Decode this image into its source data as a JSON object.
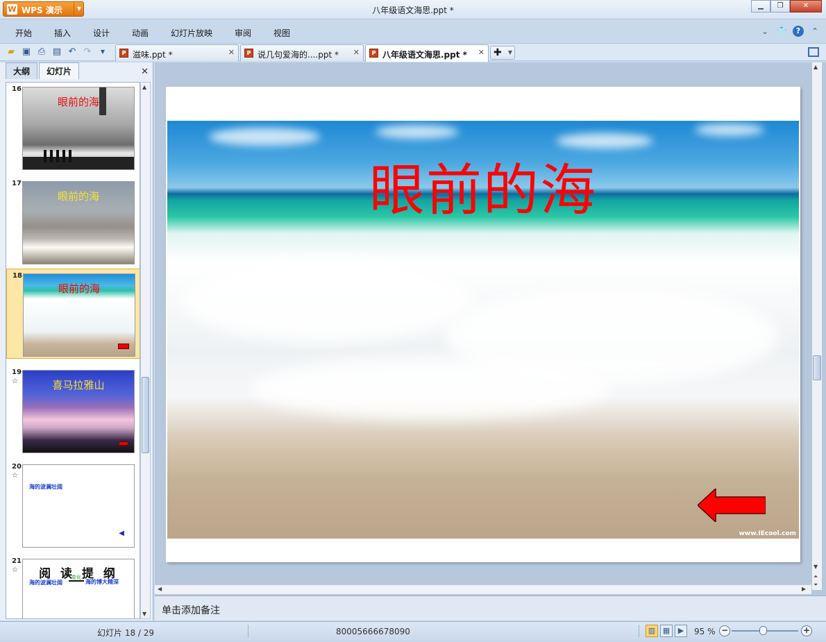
{
  "app": {
    "badge": "WPS 演示",
    "logo_glyph": "W",
    "window_title": "八年级语文海思.ppt *",
    "accent_color": "#e37310"
  },
  "menu": [
    "开始",
    "插入",
    "设计",
    "动画",
    "幻灯片放映",
    "审阅",
    "视图"
  ],
  "toolbar_icons": [
    "open-folder-icon",
    "save-icon",
    "print-icon",
    "print-preview-icon",
    "undo-icon",
    "redo-icon",
    "customize-icon"
  ],
  "tabs": [
    {
      "label": "滋味.ppt *",
      "active": false
    },
    {
      "label": "说几句爱海的....ppt *",
      "active": false
    },
    {
      "label": "八年级语文海思.ppt *",
      "active": true
    }
  ],
  "left_panel": {
    "tab_outline": "大纲",
    "tab_slides": "幻灯片",
    "thumbnails": [
      {
        "num": "16",
        "title": "眼前的海"
      },
      {
        "num": "17",
        "title": "眼前的海"
      },
      {
        "num": "18",
        "title": "眼前的海",
        "selected": true
      },
      {
        "num": "19",
        "title": "喜马拉雅山",
        "has_animation": true
      },
      {
        "num": "20",
        "text1": "海的波澜壮阔",
        "has_animation": true
      },
      {
        "num": "21",
        "title": "阅 读 提 纲",
        "text1": "海的波澜壮阔",
        "mid": "变化",
        "text2": "海的博大精深",
        "has_animation": true
      }
    ],
    "anim_glyph": "☆"
  },
  "slide": {
    "title": "眼前的海",
    "title_color": "#ff0000",
    "watermark": "www.IEcool.com"
  },
  "notes_placeholder": "单击添加备注",
  "status": {
    "slide_indicator": "幻灯片 18 / 29",
    "template_id": "80005666678090",
    "zoom": "95 %"
  }
}
